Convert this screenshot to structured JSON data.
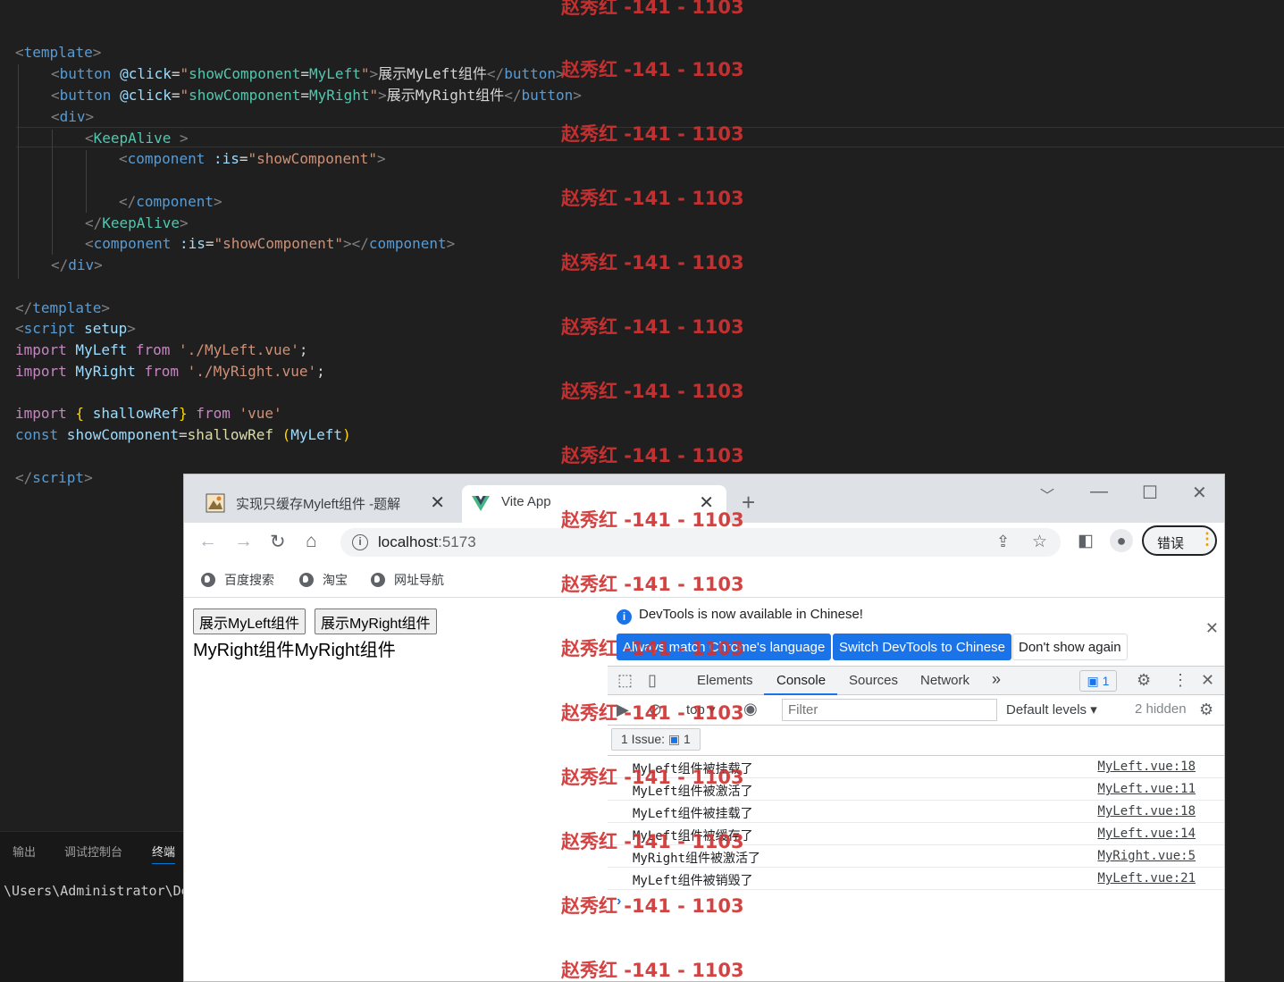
{
  "editor": {
    "lines": {
      "l1_open": "<",
      "l1_tag": "template",
      "l1_close": ">",
      "l2_open": "<",
      "l2_tag": "button",
      "l2_attr": " @click",
      "l2_eq": "=",
      "l2_q1": "\"",
      "l2_val": "showComponent",
      "l2_eq2": "=",
      "l2_val2": "MyLeft",
      "l2_q2": "\"",
      "l2_gt": ">",
      "l2_text": "展示MyLeft组件",
      "l2_end_open": "</",
      "l2_end_tag": "button",
      "l2_end_gt": ">",
      "l3_open": "<",
      "l3_tag": "button",
      "l3_attr": " @click",
      "l3_eq": "=",
      "l3_q1": "\"",
      "l3_val": "showComponent",
      "l3_eq2": "=",
      "l3_val2": "MyRight",
      "l3_q2": "\"",
      "l3_gt": ">",
      "l3_text": "展示MyRight组件",
      "l3_end_open": "</",
      "l3_end_tag": "button",
      "l3_end_gt": ">",
      "l4_open": "<",
      "l4_tag": "div",
      "l4_close": ">",
      "l5_open": "<",
      "l5_tag": "KeepAlive",
      "l5_close": " >",
      "l6_open": "<",
      "l6_tag": "component",
      "l6_attr": " :is",
      "l6_eq": "=",
      "l6_str": "\"showComponent\"",
      "l6_close": ">",
      "l8_open": "</",
      "l8_tag": "component",
      "l8_close": ">",
      "l9_open": "</",
      "l9_tag": "KeepAlive",
      "l9_close": ">",
      "l10_open": "<",
      "l10_tag": "component",
      "l10_attr": " :is",
      "l10_eq": "=",
      "l10_str": "\"showComponent\"",
      "l10_mid": "></",
      "l10_tag2": "component",
      "l10_close": ">",
      "l11_open": "</",
      "l11_tag": "div",
      "l11_close": ">",
      "l13_open": "</",
      "l13_tag": "template",
      "l13_close": ">",
      "l14_open": "<",
      "l14_tag": "script",
      "l14_attr": " setup",
      "l14_close": ">",
      "l15_kw": "import",
      "l15_id": " MyLeft",
      "l15_from": " from",
      "l15_str": " './MyLeft.vue'",
      "l15_semi": ";",
      "l16_kw": "import",
      "l16_id": " MyRight",
      "l16_from": " from",
      "l16_str": " './MyRight.vue'",
      "l16_semi": ";",
      "l18_kw": "import",
      "l18_b1": " {",
      "l18_id": " shallowRef",
      "l18_b2": "}",
      "l18_from": " from",
      "l18_str": " 'vue'",
      "l19_kw": "const",
      "l19_id": " showComponent",
      "l19_eq": "=",
      "l19_fn": "shallowRef",
      "l19_p1": " (",
      "l19_arg": "MyLeft",
      "l19_p2": ")",
      "l21_open": "</",
      "l21_tag": "script",
      "l21_close": ">"
    }
  },
  "panel": {
    "tabs": [
      "输出",
      "调试控制台",
      "终端"
    ],
    "terminal_text": "\\Users\\Administrator\\De"
  },
  "browser": {
    "tabs": [
      {
        "title": "实现只缓存Myleft组件 -题解",
        "close": "✕"
      },
      {
        "title": "Vite App",
        "close": "✕"
      }
    ],
    "new_tab": "+",
    "url_host": "localhost",
    "url_port": ":5173",
    "profile_button": "错误",
    "bookmarks": [
      "百度搜索",
      "淘宝",
      "网址导航"
    ]
  },
  "page": {
    "btn_left": "展示MyLeft组件",
    "btn_right": "展示MyRight组件",
    "text": "MyRight组件MyRight组件"
  },
  "devtools": {
    "notice": "DevTools is now available in Chinese!",
    "btn_match": "Always match Chrome's language",
    "btn_switch": "Switch DevTools to Chinese",
    "btn_dont": "Don't show again",
    "tabs": [
      "Elements",
      "Console",
      "Sources",
      "Network"
    ],
    "more": "»",
    "msg_count": "1",
    "context": "top",
    "filter_placeholder": "Filter",
    "levels": "Default levels",
    "hidden": "2 hidden",
    "issues_label": "1 Issue:",
    "issues_count": "1",
    "logs": [
      {
        "msg": "MyLeft组件被挂载了",
        "src": "MyLeft.vue:18"
      },
      {
        "msg": "MyLeft组件被激活了",
        "src": "MyLeft.vue:11"
      },
      {
        "msg": "MyLeft组件被挂载了",
        "src": "MyLeft.vue:18"
      },
      {
        "msg": "MyLeft组件被缓存了",
        "src": "MyLeft.vue:14"
      },
      {
        "msg": "MyRight组件被激活了",
        "src": "MyRight.vue:5"
      },
      {
        "msg": "MyLeft组件被销毁了",
        "src": "MyLeft.vue:21"
      }
    ],
    "prompt": "›"
  },
  "watermark": {
    "text": "赵秀红 -141 - 1103"
  },
  "colors": {
    "editor_bg": "#1f1f1f",
    "tag": "#569cd6",
    "string": "#ce9178",
    "keyword": "#c586c0",
    "accent_blue": "#1a73e8",
    "watermark": "#d23232"
  }
}
